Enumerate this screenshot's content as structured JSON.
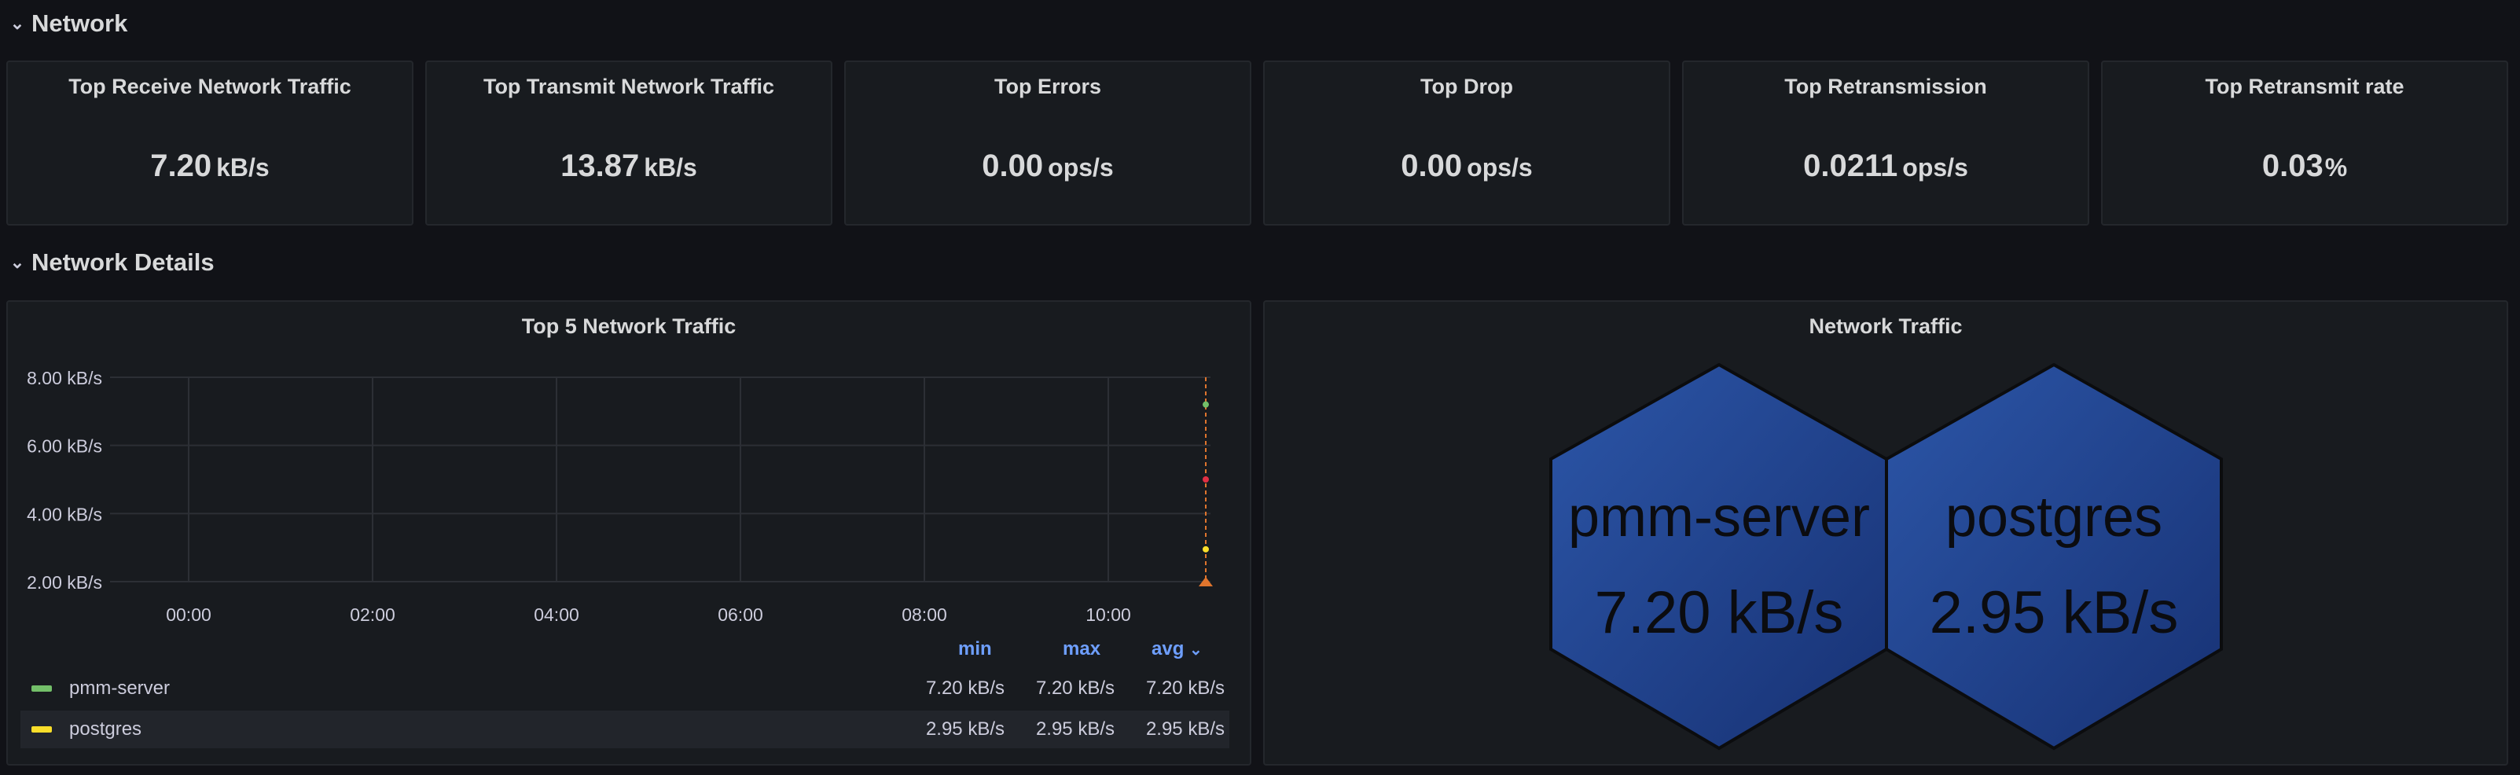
{
  "rows": {
    "network": "Network",
    "network_details": "Network Details"
  },
  "stats": [
    {
      "title": "Top Receive Network Traffic",
      "value": "7.20",
      "unit": "kB/s"
    },
    {
      "title": "Top Transmit Network Traffic",
      "value": "13.87",
      "unit": "kB/s"
    },
    {
      "title": "Top Errors",
      "value": "0.00",
      "unit": "ops/s"
    },
    {
      "title": "Top Drop",
      "value": "0.00",
      "unit": "ops/s"
    },
    {
      "title": "Top Retransmission",
      "value": "0.0211",
      "unit": "ops/s"
    },
    {
      "title": "Top Retransmit rate",
      "value": "0.03",
      "unit": "%"
    }
  ],
  "top5": {
    "title": "Top 5 Network Traffic",
    "legend_headers": {
      "min": "min",
      "max": "max",
      "avg": "avg"
    },
    "legend": [
      {
        "name": "pmm-server",
        "color": "#73bf69",
        "min": "7.20 kB/s",
        "max": "7.20 kB/s",
        "avg": "7.20 kB/s"
      },
      {
        "name": "postgres",
        "color": "#fade2a",
        "min": "2.95 kB/s",
        "max": "2.95 kB/s",
        "avg": "2.95 kB/s"
      }
    ]
  },
  "chart_data": {
    "type": "line",
    "title": "Top 5 Network Traffic",
    "x_ticks": [
      "00:00",
      "02:00",
      "04:00",
      "06:00",
      "08:00",
      "10:00"
    ],
    "y_ticks": [
      "8.00 kB/s",
      "6.00 kB/s",
      "4.00 kB/s",
      "2.00 kB/s"
    ],
    "ylim": [
      2,
      8
    ],
    "series": [
      {
        "name": "pmm-server",
        "color": "#73bf69",
        "x": "11:05",
        "y": 7.2
      },
      {
        "name": "postgres",
        "color": "#fade2a",
        "x": "11:05",
        "y": 2.95
      }
    ],
    "extra_marker": {
      "color": "#e02f44",
      "y": 5.0
    }
  },
  "hex_panel": {
    "title": "Network Traffic",
    "items": [
      {
        "name": "pmm-server",
        "value": "7.20 kB/s"
      },
      {
        "name": "postgres",
        "value": "2.95 kB/s"
      }
    ],
    "fill_top": "#2c56a8",
    "fill_bottom": "#173173"
  }
}
